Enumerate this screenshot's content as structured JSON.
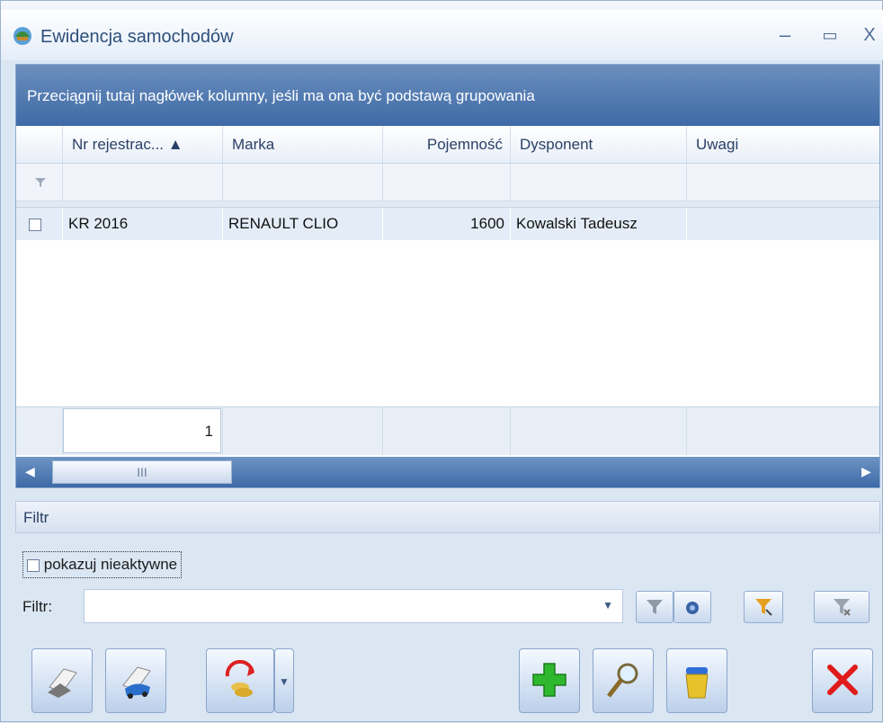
{
  "window": {
    "title": "Ewidencja samochodów",
    "minimize_glyph": "–",
    "maximize_glyph": "▭",
    "close_glyph": "X",
    "icon": "car-icon"
  },
  "grid": {
    "group_panel_text": "Przeciągnij tutaj nagłówek kolumny, jeśli ma ona być podstawą grupowania",
    "columns": [
      {
        "label": "Nr rejestrac... ▲"
      },
      {
        "label": "Marka"
      },
      {
        "label": "Pojemność"
      },
      {
        "label": "Dysponent"
      },
      {
        "label": "Uwagi"
      }
    ],
    "rows": [
      {
        "nr": "KR 2016",
        "marka": "RENAULT CLIO",
        "pojemnosc": "1600",
        "dysponent": "Kowalski Tadeusz",
        "uwagi": ""
      }
    ],
    "record_count": "1",
    "scroll_thumb_glyph": "III"
  },
  "filter": {
    "section_title": "Filtr",
    "show_inactive_label": "pokazuj nieaktywne",
    "filter_label": "Filtr:",
    "filter_value": ""
  },
  "colors": {
    "accent": "#3e6aa5",
    "add_green": "#2eb82e",
    "close_red": "#e01a1a"
  },
  "buttons": {
    "icons": [
      "print-icon",
      "car-print-icon",
      "refresh-coins-icon",
      "add-icon",
      "search-icon",
      "trash-icon",
      "close-icon"
    ]
  }
}
